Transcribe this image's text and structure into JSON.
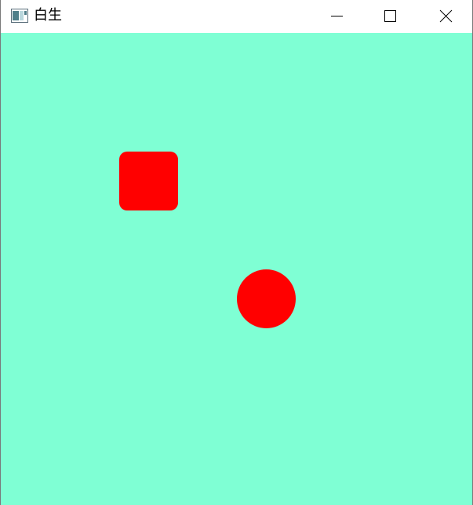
{
  "window": {
    "title": "白生",
    "icon": "app-window-icon",
    "controls": {
      "minimize_icon": "minimize-icon",
      "maximize_icon": "maximize-icon",
      "close_icon": "close-icon"
    }
  },
  "canvas": {
    "background_color": "#7fffd4",
    "shapes": [
      {
        "kind": "rounded-square",
        "color": "#ff0000"
      },
      {
        "kind": "circle",
        "color": "#ff0000"
      }
    ]
  }
}
